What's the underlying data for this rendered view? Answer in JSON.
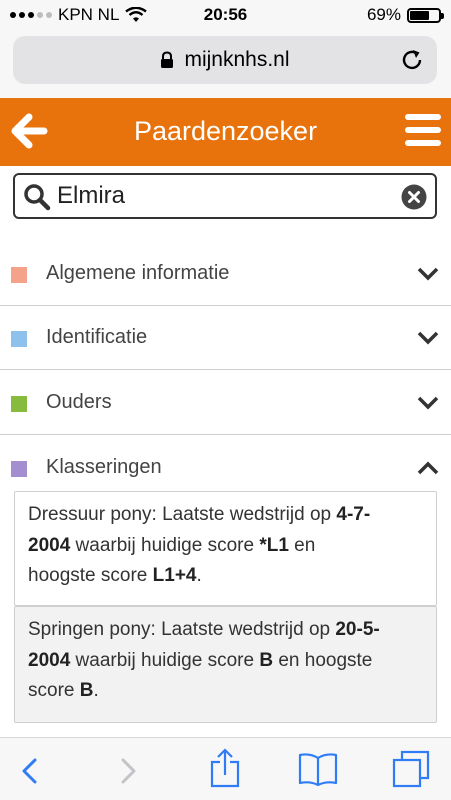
{
  "status_bar": {
    "carrier": "KPN NL",
    "time": "20:56",
    "battery": "69%",
    "battery_level": 0.69
  },
  "browser": {
    "url": "mijnknhs.nl"
  },
  "header": {
    "title": "Paardenzoeker"
  },
  "search": {
    "value": "Elmira"
  },
  "sections": [
    {
      "label": "Algemene informatie",
      "color": "#f4a28a",
      "expanded": false
    },
    {
      "label": "Identificatie",
      "color": "#8ec1eb",
      "expanded": false
    },
    {
      "label": "Ouders",
      "color": "#86bb3e",
      "expanded": false
    },
    {
      "label": "Klasseringen",
      "color": "#a38fcf",
      "expanded": true
    }
  ],
  "klasseringen": [
    {
      "line1_pre": "Dressuur pony: Laatste wedstrijd op ",
      "line1_bold": "4-7-",
      "line2_bold": "2004",
      "line2_mid": " waarbij huidige score ",
      "line2_bold2": "*L1",
      "line2_post": " en",
      "line3_pre": "hoogste score ",
      "line3_bold": "L1+4",
      "line3_post": "."
    },
    {
      "line1_pre": "Springen pony: Laatste wedstrijd op ",
      "line1_bold": "20-5-",
      "line2_bold": "2004",
      "line2_mid": " waarbij huidige score ",
      "line2_bold2": "B",
      "line2_post": " en hoogste",
      "line3_pre": "score ",
      "line3_bold": "B",
      "line3_post": "."
    }
  ],
  "colors": {
    "header": "#e8720c",
    "safari_blue": "#2f7cf6"
  }
}
